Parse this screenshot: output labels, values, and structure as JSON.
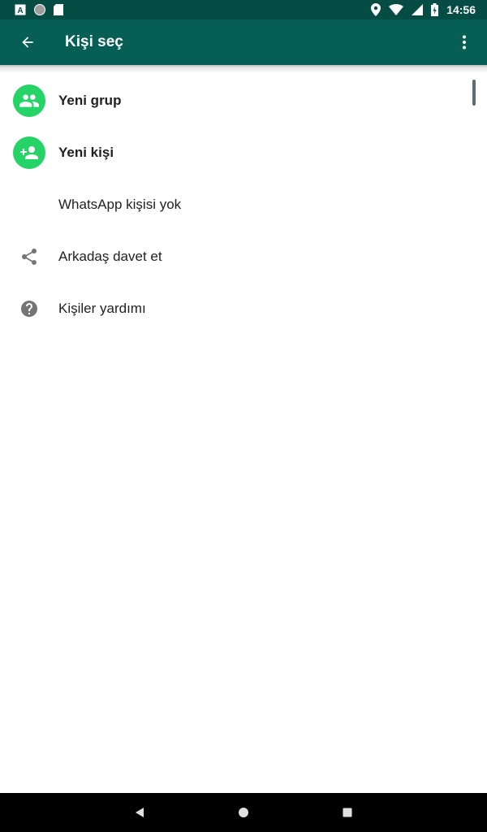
{
  "status_bar": {
    "time": "14:56",
    "left_icons": [
      "keyboard-a-icon",
      "circle-app-icon",
      "sd-card-icon"
    ],
    "right_icons": [
      "location-icon",
      "wifi-icon",
      "signal-icon",
      "battery-icon"
    ]
  },
  "app_bar": {
    "title": "Kişi seç",
    "back_icon": "back-arrow-icon",
    "menu_icon": "more-vert-icon",
    "color": "#075e54"
  },
  "list": {
    "items": [
      {
        "label": "Yeni grup",
        "icon": "group-icon",
        "style": "bold"
      },
      {
        "label": "Yeni kişi",
        "icon": "add-person-icon",
        "style": "bold"
      },
      {
        "label": "WhatsApp kişisi yok",
        "icon": "",
        "style": "normal"
      },
      {
        "label": "Arkadaş davet et",
        "icon": "share-icon",
        "style": "normal"
      },
      {
        "label": "Kişiler yardımı",
        "icon": "help-icon",
        "style": "normal"
      }
    ]
  },
  "colors": {
    "accent": "#25d366",
    "status_bar": "#054d44",
    "text": "#212121",
    "secondary_icon": "#757575"
  },
  "nav_bar": {
    "buttons": [
      "back-triangle-icon",
      "home-circle-icon",
      "recents-square-icon"
    ]
  }
}
